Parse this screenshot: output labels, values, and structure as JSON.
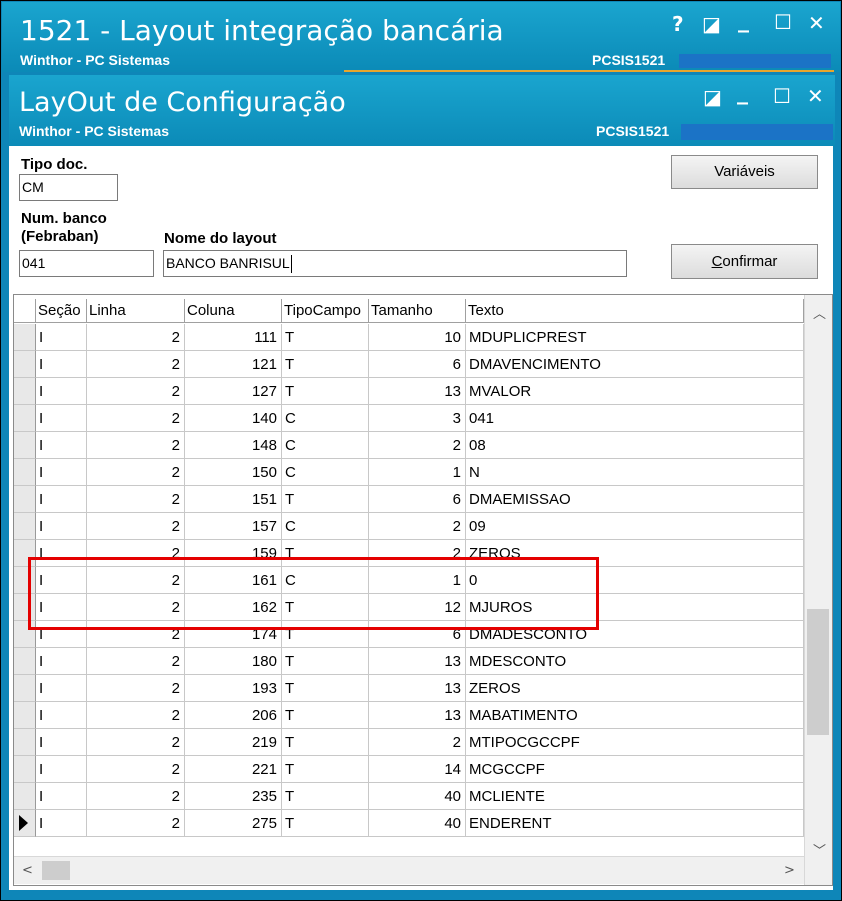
{
  "app": {
    "title": "1521 - Layout integração bancária",
    "subtitle": "Winthor - PC Sistemas",
    "code": "PCSIS1521",
    "controls": {
      "help": "?",
      "minimize": "_",
      "maximize": "☐",
      "close": "✕",
      "restore": "◪"
    }
  },
  "window": {
    "title": "LayOut de Configuração",
    "subtitle": "Winthor - PC Sistemas",
    "code": "PCSIS1521"
  },
  "form": {
    "tipo_doc_label": "Tipo doc.",
    "tipo_doc_value": "CM",
    "num_banco_label": "Num. banco",
    "num_banco_label2": "(Febraban)",
    "num_banco_value": "041",
    "nome_layout_label": "Nome do layout",
    "nome_layout_value": "BANCO BANRISUL",
    "variaveis_button": "Variáveis",
    "confirmar_button": "Confirmar"
  },
  "grid": {
    "columns": [
      "Seção",
      "Linha",
      "Coluna",
      "TipoCampo",
      "Tamanho",
      "Texto"
    ],
    "rows": [
      [
        "I",
        "2",
        "111",
        "T",
        "10",
        "MDUPLICPREST"
      ],
      [
        "I",
        "2",
        "121",
        "T",
        "6",
        "DMAVENCIMENTO"
      ],
      [
        "I",
        "2",
        "127",
        "T",
        "13",
        "MVALOR"
      ],
      [
        "I",
        "2",
        "140",
        "C",
        "3",
        "041"
      ],
      [
        "I",
        "2",
        "148",
        "C",
        "2",
        "08"
      ],
      [
        "I",
        "2",
        "150",
        "C",
        "1",
        "N"
      ],
      [
        "I",
        "2",
        "151",
        "T",
        "6",
        "DMAEMISSAO"
      ],
      [
        "I",
        "2",
        "157",
        "C",
        "2",
        "09"
      ],
      [
        "I",
        "2",
        "159",
        "T",
        "2",
        "ZEROS"
      ],
      [
        "I",
        "2",
        "161",
        "C",
        "1",
        "0"
      ],
      [
        "I",
        "2",
        "162",
        "T",
        "12",
        "MJUROS"
      ],
      [
        "I",
        "2",
        "174",
        "T",
        "6",
        "DMADESCONTO"
      ],
      [
        "I",
        "2",
        "180",
        "T",
        "13",
        "MDESCONTO"
      ],
      [
        "I",
        "2",
        "193",
        "T",
        "13",
        "ZEROS"
      ],
      [
        "I",
        "2",
        "206",
        "T",
        "13",
        "MABATIMENTO"
      ],
      [
        "I",
        "2",
        "219",
        "T",
        "2",
        "MTIPOCGCCPF"
      ],
      [
        "I",
        "2",
        "221",
        "T",
        "14",
        "MCGCCPF"
      ],
      [
        "I",
        "2",
        "235",
        "T",
        "40",
        "MCLIENTE"
      ],
      [
        "I",
        "2",
        "275",
        "T",
        "40",
        "ENDERENT"
      ]
    ],
    "current_row_index": 18,
    "highlighted_rows": [
      9,
      10
    ],
    "highlight_color": "#e40000"
  }
}
